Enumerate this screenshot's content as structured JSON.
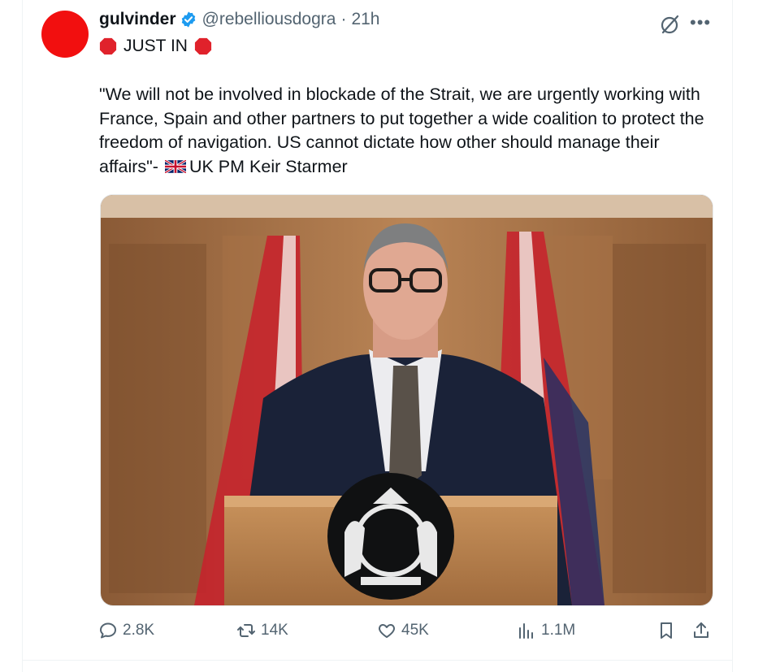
{
  "tweet": {
    "author_name": "gulvinder",
    "handle": "@rebelliousdogra",
    "separator": "·",
    "time": "21h",
    "banner": "JUST IN",
    "text_main": "\"We will not be involved in blockade of the Strait, we are urgently working with France, Spain and other partners to put together a wide coalition to protect the freedom of navigation. US cannot dictate how other should manage their affairs\"-",
    "text_attribution": "UK PM Keir Starmer"
  },
  "metrics": {
    "replies": "2.8K",
    "reposts": "14K",
    "likes": "45K",
    "views": "1.1M"
  },
  "icons": {
    "verified": "verified-badge-icon",
    "grok": "grok-icon",
    "more": "more-icon",
    "stop_sign": "stop-sign-emoji",
    "flag": "uk-flag-emoji",
    "reply": "reply-icon",
    "repost": "repost-icon",
    "like": "heart-icon",
    "views": "views-icon",
    "bookmark": "bookmark-icon",
    "share": "share-icon"
  },
  "colors": {
    "avatar": "#f20f0f",
    "verified": "#1d9bf0",
    "stop_sign": "#e0222b",
    "text_secondary": "#536471"
  }
}
